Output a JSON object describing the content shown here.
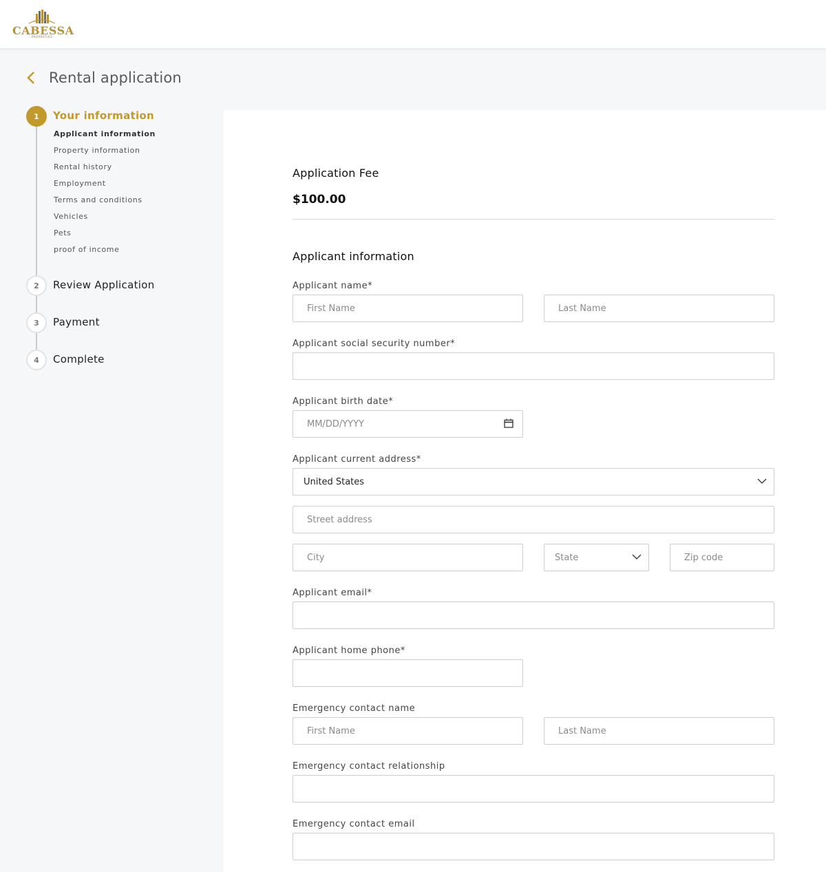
{
  "brand": {
    "name": "CABESSA",
    "tagline": "PROPERTIES"
  },
  "page": {
    "title": "Rental application"
  },
  "stepper": {
    "steps": [
      {
        "number": "1",
        "label": "Your information"
      },
      {
        "number": "2",
        "label": "Review Application"
      },
      {
        "number": "3",
        "label": "Payment"
      },
      {
        "number": "4",
        "label": "Complete"
      }
    ],
    "substeps": [
      "Applicant information",
      "Property information",
      "Rental history",
      "Employment",
      "Terms and conditions",
      "Vehicles",
      "Pets",
      "proof of income"
    ]
  },
  "fee": {
    "title": "Application Fee",
    "amount": "$100.00"
  },
  "section": {
    "title": "Applicant information"
  },
  "fields": {
    "name": {
      "label": "Applicant name*",
      "first_placeholder": "First Name",
      "last_placeholder": "Last Name"
    },
    "ssn": {
      "label": "Applicant social security number*"
    },
    "birth": {
      "label": "Applicant birth date*",
      "placeholder": "MM/DD/YYYY"
    },
    "address": {
      "label": "Applicant current address*",
      "country": "United States",
      "street_placeholder": "Street address",
      "city_placeholder": "City",
      "state_placeholder": "State",
      "zip_placeholder": "Zip code"
    },
    "email": {
      "label": "Applicant email*"
    },
    "phone": {
      "label": "Applicant home phone*"
    },
    "emergency_name": {
      "label": "Emergency contact name",
      "first_placeholder": "First Name",
      "last_placeholder": "Last Name"
    },
    "emergency_relationship": {
      "label": "Emergency contact relationship"
    },
    "emergency_email": {
      "label": "Emergency contact email"
    }
  },
  "colors": {
    "accent": "#c29a2c",
    "border": "#cfcfcf",
    "sidebar_bg": "#f6f7f8"
  },
  "icons": [
    "back-chevron-icon",
    "calendar-icon",
    "chevron-down-icon",
    "building-logo-icon"
  ]
}
